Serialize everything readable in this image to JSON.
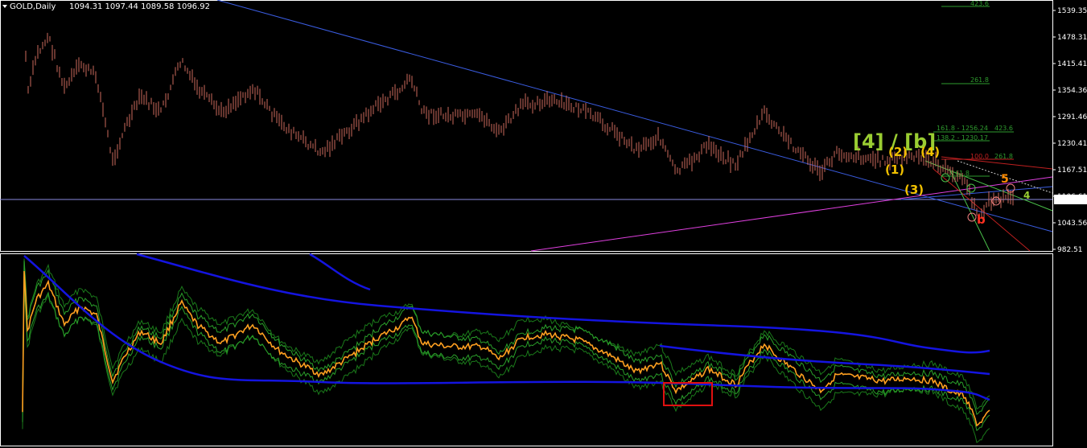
{
  "header": {
    "symbol_tf": "GOLD,Daily",
    "ohlc": "1094.31 1097.44 1089.58 1096.92"
  },
  "chart_data": {
    "type": "line",
    "price_axis": {
      "ticks": [
        "1539.35",
        "1478.31",
        "1415.41",
        "1354.36",
        "1291.46",
        "1230.41",
        "1167.51",
        "1106.61",
        "1043.56",
        "982.51"
      ],
      "current_price": "1096.92",
      "ylim": [
        982.51,
        1539.35
      ]
    },
    "fib_levels": [
      {
        "label": "423.6",
        "color": "#2e9b2e"
      },
      {
        "label": "261.8",
        "color": "#2e9b2e"
      },
      {
        "label": "161.8 - 1256.24",
        "color": "#2e9b2e"
      },
      {
        "label": "423.6",
        "color": "#2e9b2e"
      },
      {
        "label": "138.2 - 1230.17",
        "color": "#2e9b2e"
      },
      {
        "label": "100.0",
        "color": "#c02020"
      },
      {
        "label": "261.8",
        "color": "#2e9b2e"
      },
      {
        "label": "161.8",
        "color": "#2e9b2e"
      }
    ],
    "wave_labels": [
      {
        "text": "[4] / [b]",
        "color": "#9acd32"
      },
      {
        "text": "(2)",
        "color": "#f0c000"
      },
      {
        "text": "(4)",
        "color": "#f0c000"
      },
      {
        "text": "(1)",
        "color": "#f0c000"
      },
      {
        "text": "(3)",
        "color": "#f0c000"
      },
      {
        "text": "5",
        "color": "#ff8c00"
      },
      {
        "text": "4",
        "color": "#9acd32"
      },
      {
        "text": "b",
        "color": "#ff3020"
      }
    ],
    "colors": {
      "bars": "#cd6a5c",
      "trend_blue": "#3a5ce0",
      "trend_magenta": "#e040e0",
      "hline": "#8a8ae0",
      "ind_main": "#ffa020",
      "ind_envelope": "#1a7a1a",
      "ind_band": "#1414e0",
      "highlight_box": "#e01010"
    }
  }
}
